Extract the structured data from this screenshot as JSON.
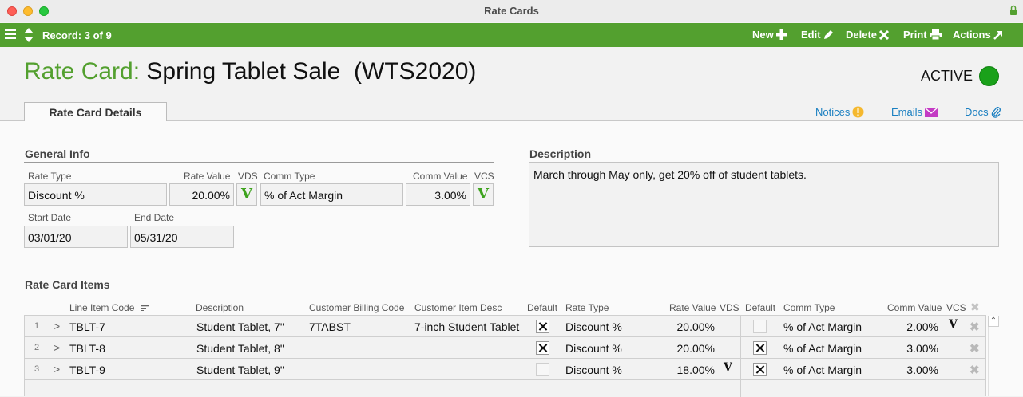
{
  "window": {
    "title": "Rate Cards"
  },
  "toolbar": {
    "record_label": "Record: 3 of 9",
    "new_label": "New",
    "edit_label": "Edit",
    "delete_label": "Delete",
    "print_label": "Print",
    "actions_label": "Actions"
  },
  "header": {
    "label": "Rate Card:",
    "name": "Spring Tablet Sale  (WTS2020)",
    "status": "ACTIVE",
    "status_color": "#1aa11a"
  },
  "tabs": [
    {
      "label": "Rate Card Details"
    }
  ],
  "links": {
    "notices": "Notices",
    "emails": "Emails",
    "docs": "Docs"
  },
  "general_info": {
    "title": "General Info",
    "labels": {
      "rate_type": "Rate Type",
      "rate_value": "Rate Value",
      "vds": "VDS",
      "comm_type": "Comm Type",
      "comm_value": "Comm Value",
      "vcs": "VCS",
      "start_date": "Start Date",
      "end_date": "End Date"
    },
    "values": {
      "rate_type": "Discount %",
      "rate_value": "20.00%",
      "vds_mark": "V",
      "comm_type": "% of Act Margin",
      "comm_value": "3.00%",
      "vcs_mark": "V",
      "start_date": "03/01/20",
      "end_date": "05/31/20"
    }
  },
  "description": {
    "title": "Description",
    "text": "March through May only, get 20% off of student tablets."
  },
  "items": {
    "title": "Rate Card Items",
    "columns": {
      "line_item_code": "Line Item Code",
      "description": "Description",
      "customer_billing_code": "Customer Billing Code",
      "customer_item_desc": "Customer Item Desc",
      "default": "Default",
      "rate_type": "Rate Type",
      "rate_value": "Rate Value",
      "vds": "VDS",
      "default2": "Default",
      "comm_type": "Comm Type",
      "comm_value": "Comm Value",
      "vcs": "VCS"
    },
    "rows": [
      {
        "num": "1",
        "code": "TBLT-7",
        "description": "Student Tablet, 7\"",
        "billing_code": "7TABST",
        "item_desc": "7-inch Student Tablet",
        "default": true,
        "rate_type": "Discount %",
        "rate_value": "20.00%",
        "vds": "",
        "default2": false,
        "comm_type": "% of Act Margin",
        "comm_value": "2.00%",
        "vcs": "V"
      },
      {
        "num": "2",
        "code": "TBLT-8",
        "description": "Student Tablet, 8\"",
        "billing_code": "",
        "item_desc": "",
        "default": true,
        "rate_type": "Discount %",
        "rate_value": "20.00%",
        "vds": "",
        "default2": true,
        "comm_type": "% of Act Margin",
        "comm_value": "3.00%",
        "vcs": ""
      },
      {
        "num": "3",
        "code": "TBLT-9",
        "description": "Student Tablet, 9\"",
        "billing_code": "",
        "item_desc": "",
        "default": false,
        "rate_type": "Discount %",
        "rate_value": "18.00%",
        "vds": "V",
        "default2": true,
        "comm_type": "% of Act Margin",
        "comm_value": "3.00%",
        "vcs": ""
      }
    ]
  },
  "colors": {
    "brand_green": "#53a02f",
    "link_blue": "#1a7fc1",
    "check_green": "#3ea31e"
  }
}
